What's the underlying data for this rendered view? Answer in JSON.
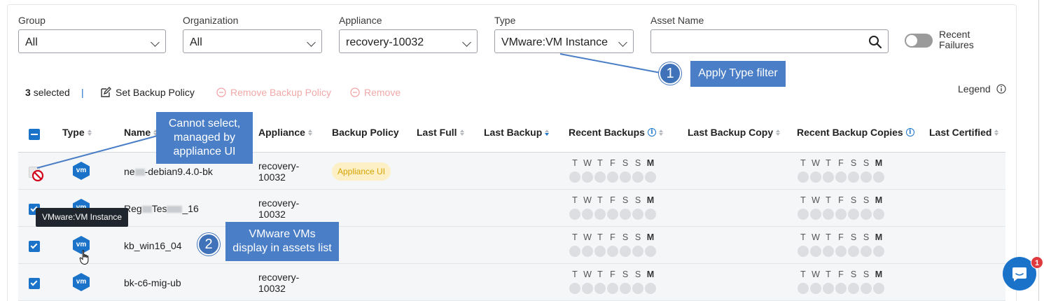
{
  "filters": {
    "group": {
      "label": "Group",
      "value": "All"
    },
    "organization": {
      "label": "Organization",
      "value": "All"
    },
    "appliance": {
      "label": "Appliance",
      "value": "recovery-10032"
    },
    "type": {
      "label": "Type",
      "value": "VMware:VM Instance"
    },
    "asset_name": {
      "label": "Asset Name",
      "value": ""
    },
    "recent_failures": {
      "label": "Recent Failures",
      "enabled": false
    }
  },
  "toolbar": {
    "selected_count": "3",
    "selected_suffix": "selected",
    "separator": "|",
    "set_backup_policy": "Set Backup Policy",
    "remove_backup_policy": "Remove Backup Policy",
    "remove": "Remove",
    "legend": "Legend"
  },
  "columns": {
    "type": "Type",
    "name": "Name",
    "appliance": "Appliance",
    "backup_policy": "Backup Policy",
    "last_full": "Last Full",
    "last_backup": "Last Backup",
    "recent_backups": "Recent Backups",
    "last_backup_copy": "Last Backup Copy",
    "recent_backup_copies": "Recent Backup Copies",
    "last_certified": "Last Certified"
  },
  "days": [
    "T",
    "W",
    "T",
    "F",
    "S",
    "S",
    "M"
  ],
  "type_icon_text": "vm",
  "rows": [
    {
      "name_a": "ne",
      "name_b": "-debian9.4.0-bk",
      "appliance_1": "recovery-",
      "appliance_2": "10032",
      "policy": "Appliance UI",
      "selectable": false
    },
    {
      "name_a": "Reg",
      "name_b": "Tes",
      "name_c": "_16",
      "appliance_1": "recovery-",
      "appliance_2": "10032",
      "selected": true
    },
    {
      "name": "kb_win16_04",
      "selected": true
    },
    {
      "name": "bk-c6-mig-ub",
      "appliance_1": "recovery-",
      "appliance_2": "10032",
      "selected": true
    }
  ],
  "tooltip": "VMware:VM Instance",
  "annotations": {
    "step1_number": "1",
    "step1_text": "Apply Type filter",
    "step2_number": "2",
    "step2_text_1": "VMware VMs",
    "step2_text_2": "display in assets list",
    "note_text_1": "Cannot select,",
    "note_text_2": "managed by",
    "note_text_3": "appliance UI"
  },
  "chat_badge": "1",
  "colors": {
    "accent": "#1a73c9",
    "callout": "#4a7ec6",
    "badge_bg": "#fdf0c7",
    "badge_text": "#d4a300",
    "disabled_red": "#f1a8a8"
  }
}
